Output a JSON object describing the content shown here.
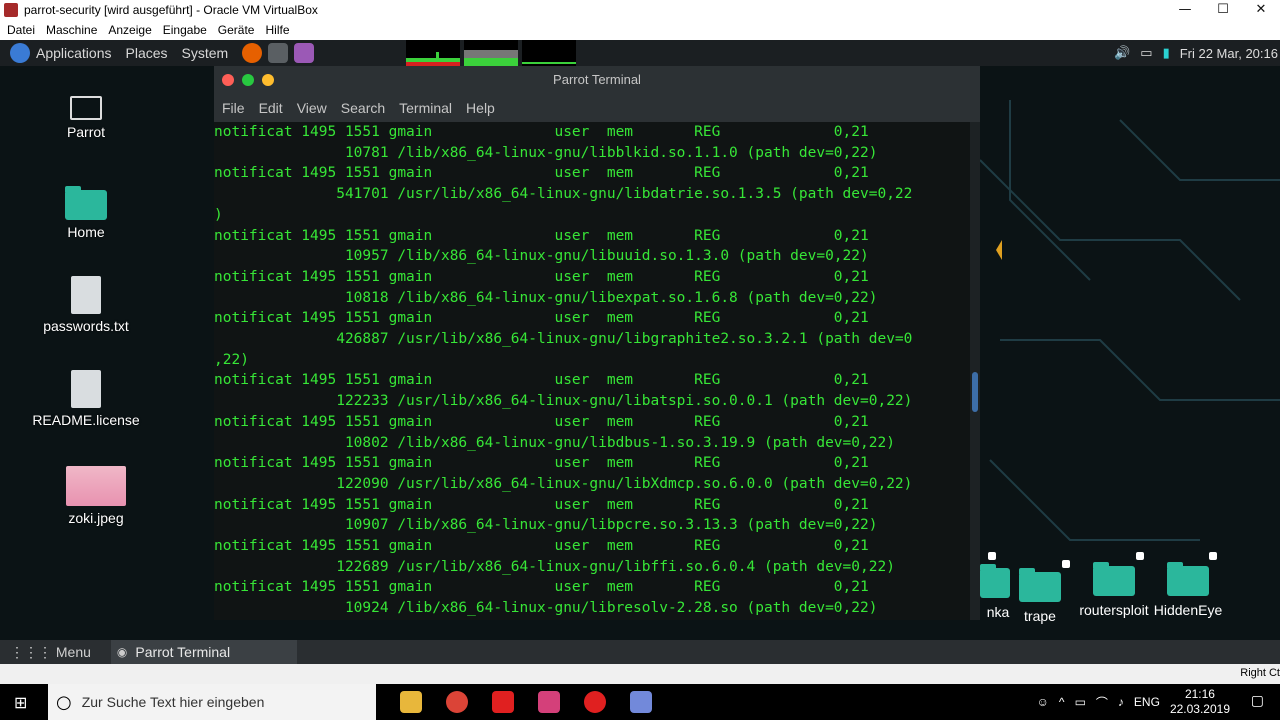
{
  "vbox": {
    "title": "parrot-security [wird ausgeführt] - Oracle VM VirtualBox",
    "menu": [
      "Datei",
      "Maschine",
      "Anzeige",
      "Eingabe",
      "Geräte",
      "Hilfe"
    ],
    "controls": {
      "minimize": "—",
      "maximize": "☐",
      "close": "✕"
    },
    "status_right": "Right Ct"
  },
  "guest_panel": {
    "applications": "Applications",
    "places": "Places",
    "system": "System",
    "clock": "Fri 22 Mar, 20:16"
  },
  "desktop_icons": [
    {
      "label": "Parrot",
      "icon": "computer-icon"
    },
    {
      "label": "Home",
      "icon": "home-folder-icon"
    },
    {
      "label": "passwords.txt",
      "icon": "text-file-icon"
    },
    {
      "label": "README.license",
      "icon": "text-file-icon"
    },
    {
      "label": "zoki.jpeg",
      "icon": "image-file-icon"
    }
  ],
  "terminal": {
    "title": "Parrot Terminal",
    "menu": [
      "File",
      "Edit",
      "View",
      "Search",
      "Terminal",
      "Help"
    ],
    "lines": [
      "notificat 1495 1551 gmain              user  mem       REG             0,21",
      "               10781 /lib/x86_64-linux-gnu/libblkid.so.1.1.0 (path dev=0,22)",
      "notificat 1495 1551 gmain              user  mem       REG             0,21",
      "              541701 /usr/lib/x86_64-linux-gnu/libdatrie.so.1.3.5 (path dev=0,22",
      ")",
      "notificat 1495 1551 gmain              user  mem       REG             0,21",
      "               10957 /lib/x86_64-linux-gnu/libuuid.so.1.3.0 (path dev=0,22)",
      "notificat 1495 1551 gmain              user  mem       REG             0,21",
      "               10818 /lib/x86_64-linux-gnu/libexpat.so.1.6.8 (path dev=0,22)",
      "notificat 1495 1551 gmain              user  mem       REG             0,21",
      "              426887 /usr/lib/x86_64-linux-gnu/libgraphite2.so.3.2.1 (path dev=0",
      ",22)",
      "notificat 1495 1551 gmain              user  mem       REG             0,21",
      "              122233 /usr/lib/x86_64-linux-gnu/libatspi.so.0.0.1 (path dev=0,22)",
      "notificat 1495 1551 gmain              user  mem       REG             0,21",
      "               10802 /lib/x86_64-linux-gnu/libdbus-1.so.3.19.9 (path dev=0,22)",
      "notificat 1495 1551 gmain              user  mem       REG             0,21",
      "              122090 /usr/lib/x86_64-linux-gnu/libXdmcp.so.6.0.0 (path dev=0,22)",
      "notificat 1495 1551 gmain              user  mem       REG             0,21",
      "               10907 /lib/x86_64-linux-gnu/libpcre.so.3.13.3 (path dev=0,22)",
      "notificat 1495 1551 gmain              user  mem       REG             0,21",
      "              122689 /usr/lib/x86_64-linux-gnu/libffi.so.6.0.4 (path dev=0,22)",
      "notificat 1495 1551 gmain              user  mem       REG             0,21",
      "               10924 /lib/x86_64-linux-gnu/libresolv-2.28.so (path dev=0,22)"
    ]
  },
  "right_folders": [
    {
      "label": "nka"
    },
    {
      "label": "trape"
    },
    {
      "label": "routersploit"
    },
    {
      "label": "HiddenEye"
    }
  ],
  "guest_bottom": {
    "menu": "Menu",
    "task": "Parrot Terminal"
  },
  "win_taskbar": {
    "search_placeholder": "Zur Suche Text hier eingeben",
    "lang": "ENG",
    "time": "21:16",
    "date": "22.03.2019"
  },
  "colors": {
    "terminal_text": "#37e637",
    "folder": "#2bb79c"
  }
}
